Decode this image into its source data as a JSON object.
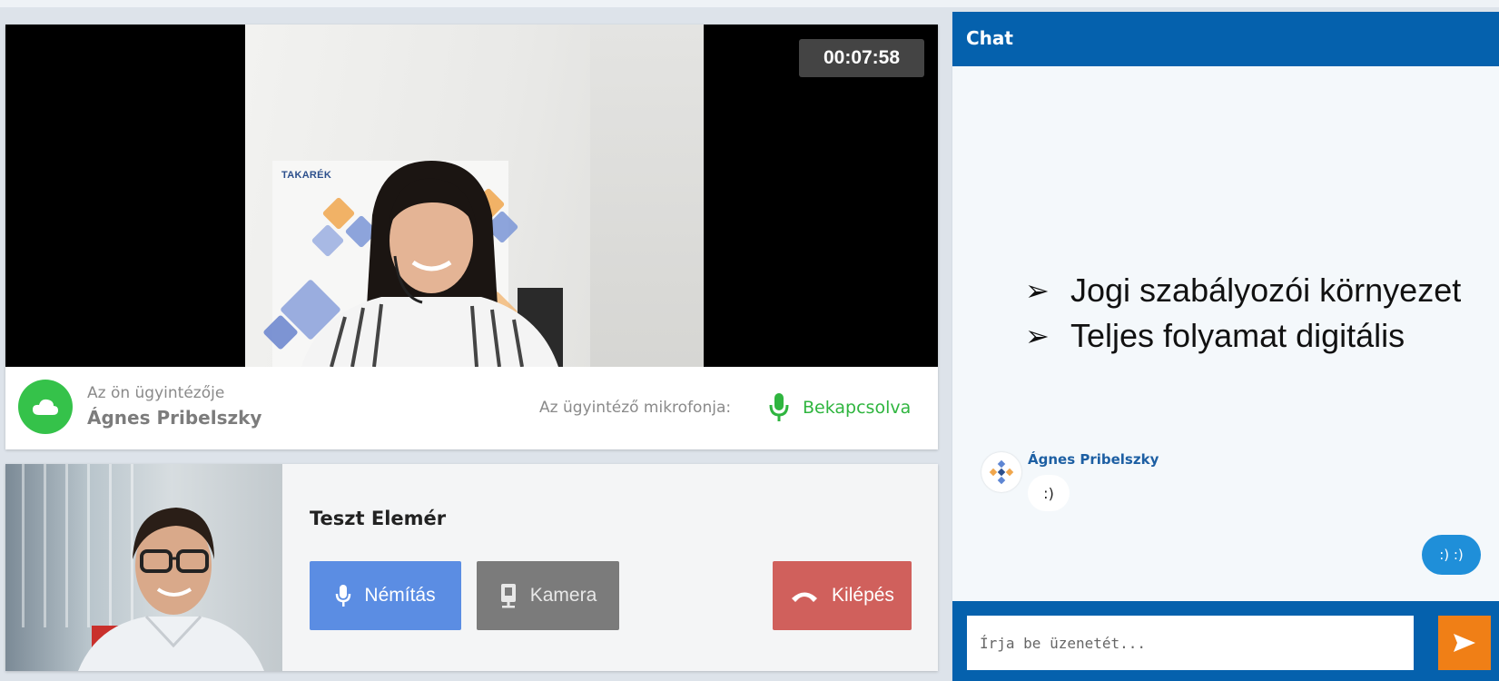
{
  "call": {
    "timer": "00:07:58",
    "banner_logo": "TAKARÉK"
  },
  "agent": {
    "subtitle": "Az ön ügyintézője",
    "name": "Ágnes Pribelszky",
    "mic_label": "Az ügyintéző mikrofonja:",
    "mic_status": "Bekapcsolva"
  },
  "self": {
    "name": "Teszt Elemér",
    "buttons": {
      "mute": "Némítás",
      "camera": "Kamera",
      "exit": "Kilépés"
    }
  },
  "chat": {
    "title": "Chat",
    "overlay_bullets": [
      "Jogi szabályozói környezet",
      "Teljes folyamat digitális"
    ],
    "messages": [
      {
        "sender": "Ágnes Pribelszky",
        "text": ":)"
      },
      {
        "sender": "",
        "text": ":) :)"
      }
    ],
    "input_placeholder": "Írja be üzenetét..."
  },
  "colors": {
    "header_blue": "#0561ad",
    "status_green": "#2fb53f",
    "mute_blue": "#5b8de3",
    "camera_gray": "#7b7b7b",
    "exit_red": "#d0605c",
    "send_orange": "#f07f16",
    "out_bubble_blue": "#1f8fd9"
  },
  "icons": {
    "agent_avatar": "cloud-icon",
    "mic": "microphone-icon",
    "camera": "webcam-icon",
    "exit": "hang-up-phone-icon",
    "send": "send-arrow-icon",
    "chat_avatar": "takarek-logo-icon",
    "bullet": "arrowhead-bullet"
  }
}
